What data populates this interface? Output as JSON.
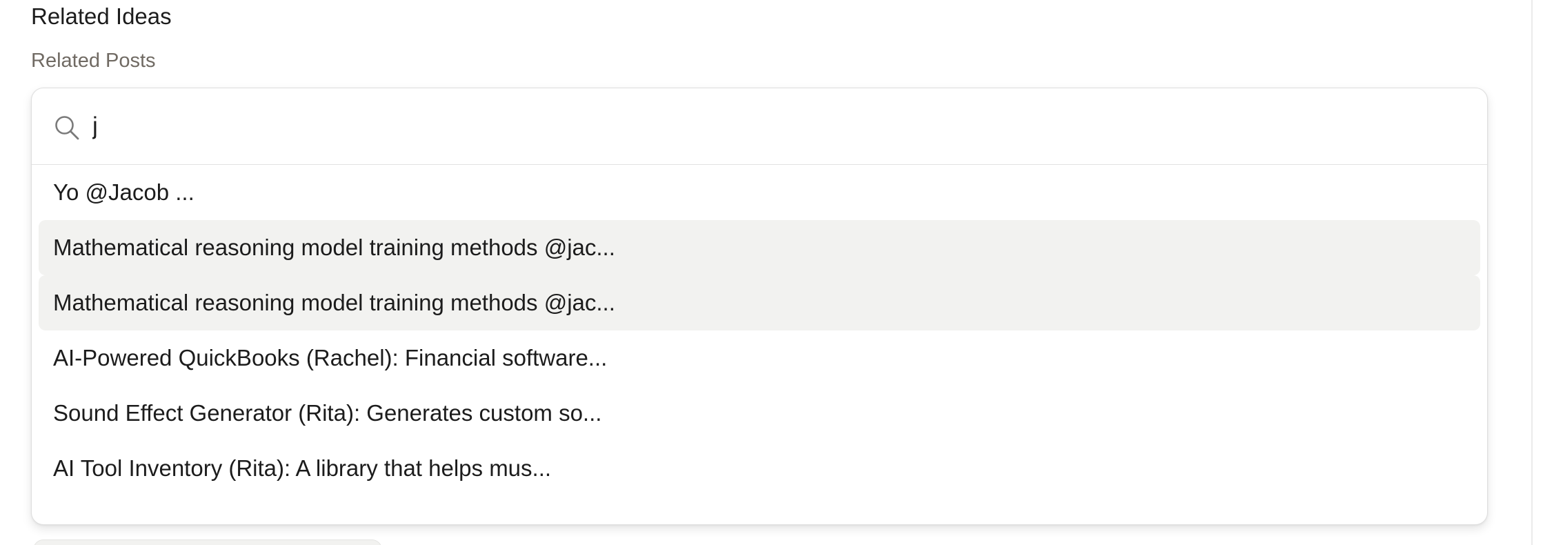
{
  "section": {
    "title": "Related Ideas",
    "field_label": "Related Posts"
  },
  "search": {
    "value": "j",
    "icon": "search-icon"
  },
  "results": [
    {
      "label": "Yo @Jacob ...",
      "highlighted": false
    },
    {
      "label": "Mathematical reasoning model training methods @jac...",
      "highlighted": true
    },
    {
      "label": "Mathematical reasoning model training methods @jac...",
      "highlighted": true
    },
    {
      "label": "AI-Powered QuickBooks (Rachel): Financial software...",
      "highlighted": false
    },
    {
      "label": "Sound Effect Generator (Rita): Generates custom so...",
      "highlighted": false
    },
    {
      "label": "AI Tool Inventory (Rita): A library that helps mus...",
      "highlighted": false
    }
  ],
  "colors": {
    "text": "#1c1c1c",
    "muted_label": "#706a63",
    "highlight_bg": "#f2f2f0",
    "border": "#dedede"
  }
}
